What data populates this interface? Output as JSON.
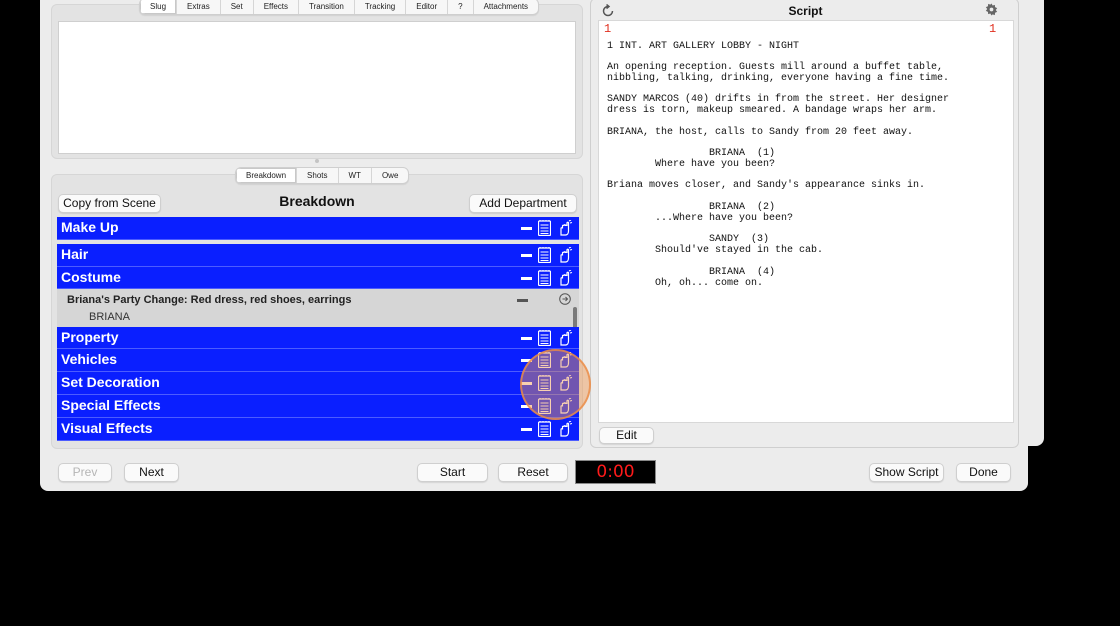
{
  "top_tabs": [
    "Slug",
    "Extras",
    "Set",
    "Effects",
    "Transition",
    "Tracking",
    "Editor",
    "?",
    "Attachments"
  ],
  "breakdown_tabs": [
    "Breakdown",
    "Shots",
    "WT",
    "Owe"
  ],
  "breakdown": {
    "copy_label": "Copy from Scene",
    "title": "Breakdown",
    "add_label": "Add Department",
    "departments": [
      "Make Up",
      "Hair",
      "Costume",
      "Property",
      "Vehicles",
      "Set Decoration",
      "Special Effects",
      "Visual Effects"
    ],
    "costume_item": {
      "title": "Briana's Party Change: Red dress, red shoes, earrings",
      "character": "BRIANA"
    }
  },
  "footer": {
    "prev": "Prev",
    "next": "Next",
    "start": "Start",
    "reset": "Reset",
    "timer": "0:00",
    "show_script": "Show Script",
    "done": "Done"
  },
  "script": {
    "title": "Script",
    "page_left": "1",
    "page_right": "1",
    "edit": "Edit",
    "lines": [
      "1 INT. ART GALLERY LOBBY - NIGHT",
      "",
      "An opening reception. Guests mill around a buffet table,",
      "nibbling, talking, drinking, everyone having a fine time.",
      "",
      "SANDY MARCOS (40) drifts in from the street. Her designer",
      "dress is torn, makeup smeared. A bandage wraps her arm.",
      "",
      "BRIANA, the host, calls to Sandy from 20 feet away.",
      "",
      "                 BRIANA  (1)",
      "        Where have you been?",
      "",
      "Briana moves closer, and Sandy's appearance sinks in.",
      "",
      "                 BRIANA  (2)",
      "        ...Where have you been?",
      "",
      "                 SANDY  (3)",
      "        Should've stayed in the cab.",
      "",
      "                 BRIANA  (4)",
      "        Oh, oh... come on."
    ]
  },
  "colors": {
    "department_bar": "#0a1fff",
    "timer_text": "#ff1a1a",
    "page_number": "#e03020"
  },
  "icons": [
    "minus-icon",
    "notepad-icon",
    "hand-pointer-icon",
    "refresh-icon",
    "gear-icon",
    "arrow-circle-icon"
  ]
}
